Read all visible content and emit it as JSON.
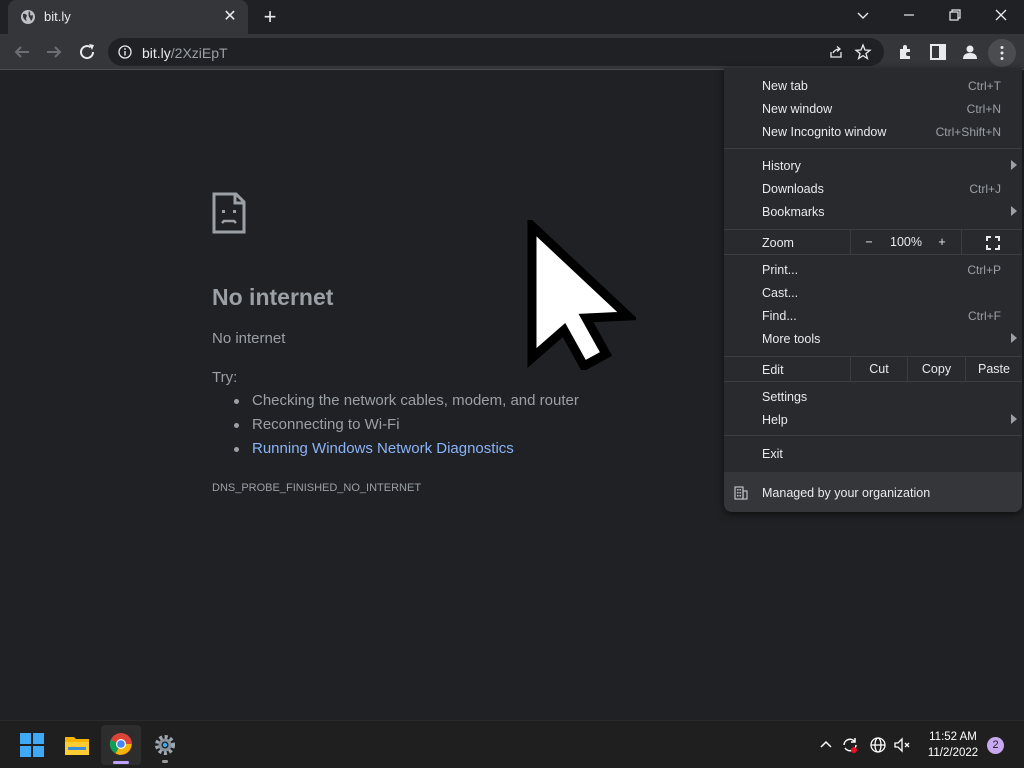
{
  "browser": {
    "tab": {
      "title": "bit.ly"
    },
    "url": {
      "host": "bit.ly",
      "path": "/2XziEpT"
    }
  },
  "error_page": {
    "title": "No internet",
    "subtitle": "No internet",
    "try_label": "Try:",
    "suggestions": [
      "Checking the network cables, modem, and router",
      "Reconnecting to Wi-Fi",
      "Running Windows Network Diagnostics"
    ],
    "error_code": "DNS_PROBE_FINISHED_NO_INTERNET"
  },
  "menu": {
    "items": [
      {
        "label": "New tab",
        "shortcut": "Ctrl+T"
      },
      {
        "label": "New window",
        "shortcut": "Ctrl+N"
      },
      {
        "label": "New Incognito window",
        "shortcut": "Ctrl+Shift+N"
      },
      {
        "label": "History",
        "shortcut": ""
      },
      {
        "label": "Downloads",
        "shortcut": "Ctrl+J"
      },
      {
        "label": "Bookmarks",
        "shortcut": ""
      },
      {
        "label": "Print...",
        "shortcut": "Ctrl+P"
      },
      {
        "label": "Cast...",
        "shortcut": ""
      },
      {
        "label": "Find...",
        "shortcut": "Ctrl+F"
      },
      {
        "label": "More tools",
        "shortcut": ""
      },
      {
        "label": "Settings",
        "shortcut": ""
      },
      {
        "label": "Help",
        "shortcut": ""
      },
      {
        "label": "Exit",
        "shortcut": ""
      }
    ],
    "zoom": {
      "label": "Zoom",
      "minus": "−",
      "value": "100%",
      "plus": "+"
    },
    "edit": {
      "label": "Edit",
      "cut": "Cut",
      "copy": "Copy",
      "paste": "Paste"
    },
    "managed": "Managed by your organization"
  },
  "taskbar": {
    "time": "11:52 AM",
    "date": "11/2/2022",
    "notifications": "2"
  },
  "colors": {
    "page_bg": "#202124",
    "toolbar_bg": "#35363a",
    "menu_bg": "#292a2d",
    "link": "#8ab4f8",
    "muted_text": "#9aa0a6"
  }
}
